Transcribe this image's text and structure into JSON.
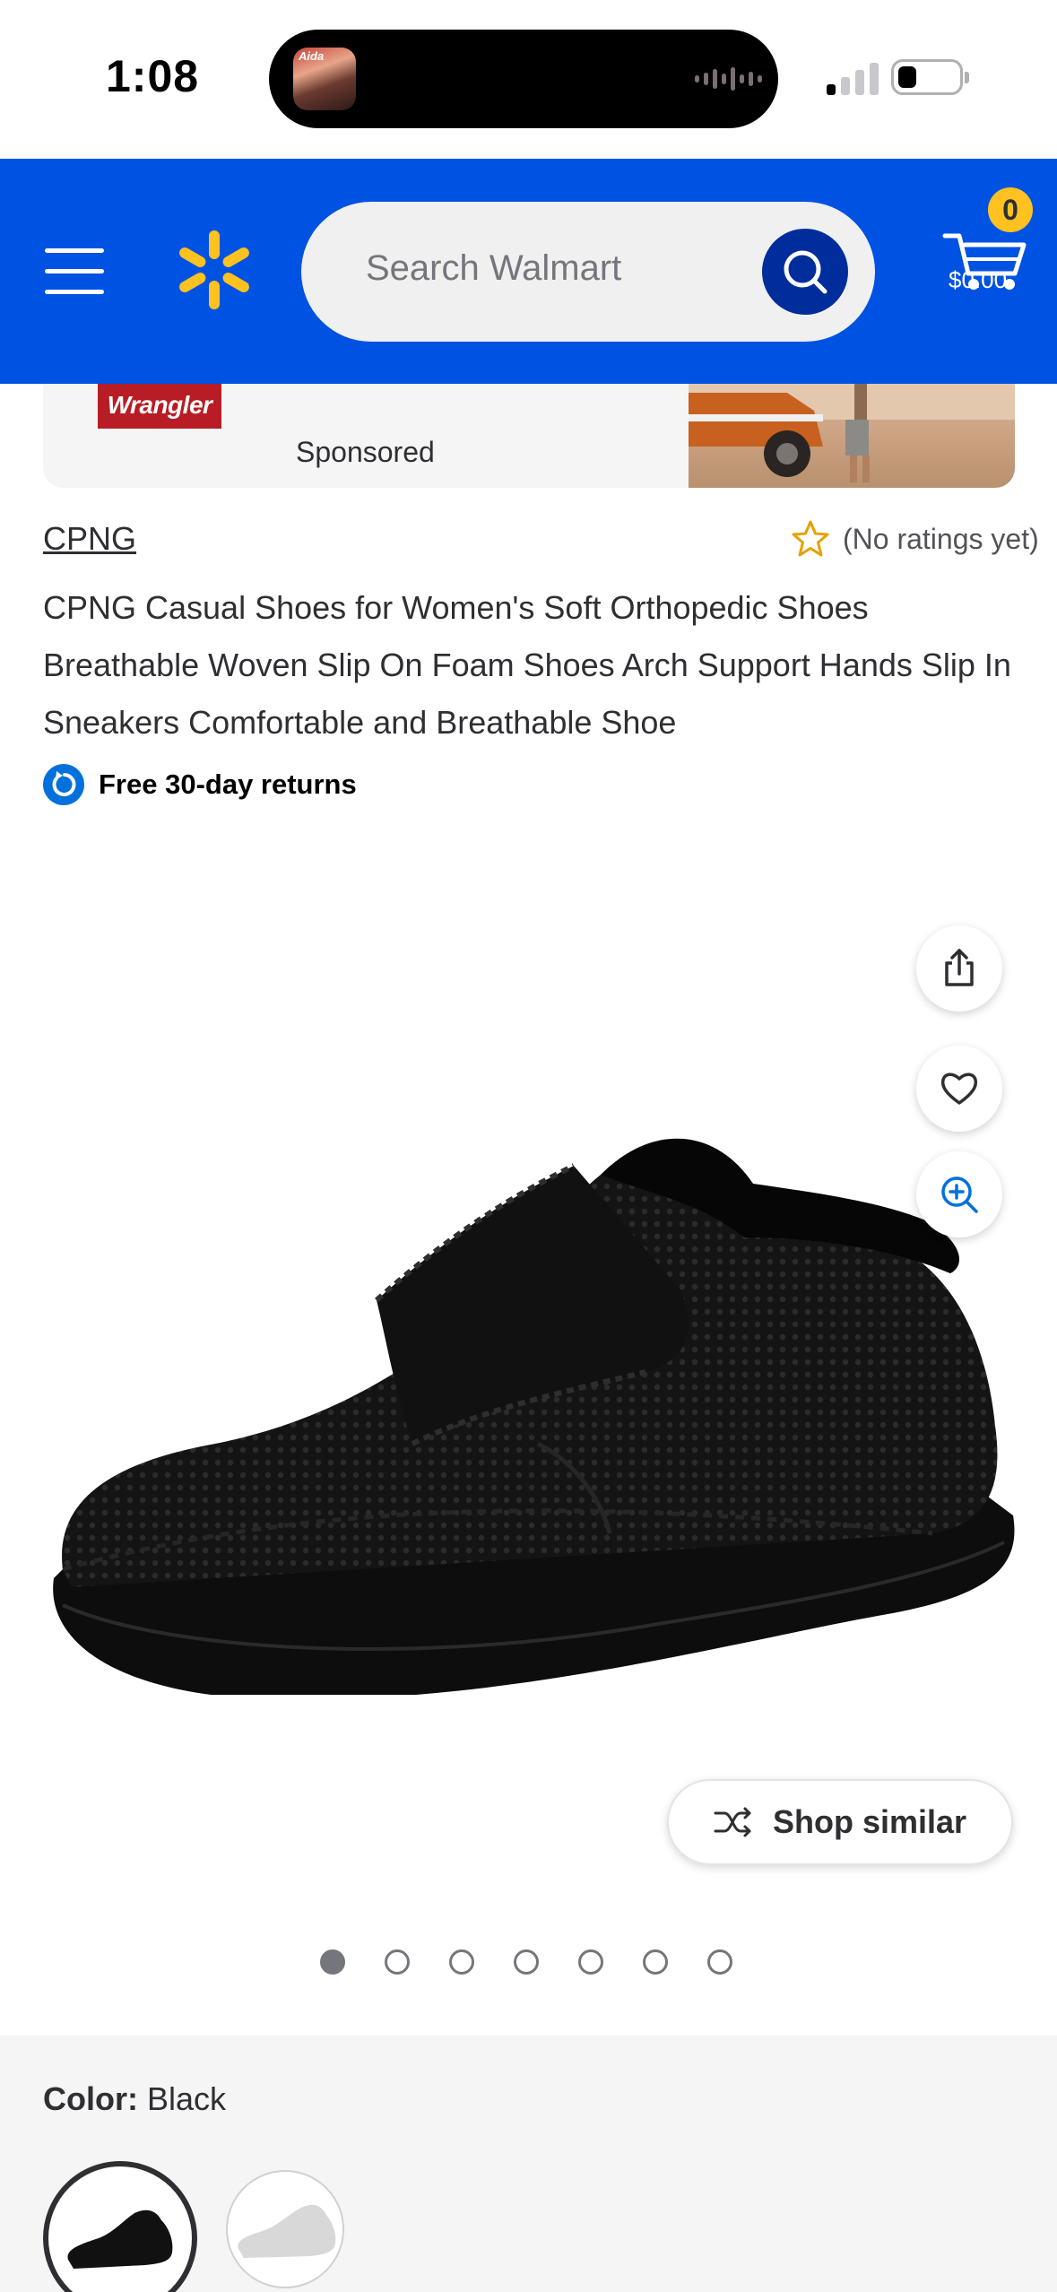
{
  "status_bar": {
    "time": "1:08",
    "island_art_label": "Aida"
  },
  "header": {
    "search_placeholder": "Search Walmart",
    "cart_count": "0",
    "cart_total": "$0.00",
    "brand_color": "#0053e2",
    "spark_color": "#ffc220"
  },
  "ad": {
    "logo_text": "Wrangler",
    "sponsored_label": "Sponsored"
  },
  "product": {
    "brand": "CPNG",
    "rating_text": "(No ratings yet)",
    "title": "CPNG Casual Shoes for Women's Soft Orthopedic Shoes Breathable Woven Slip On Foam Shoes Arch Support Hands Slip In Sneakers Comfortable and Breathable Shoe",
    "returns": "Free 30-day returns"
  },
  "image_actions": {
    "share_icon": "share-icon",
    "favorite_icon": "heart-icon",
    "zoom_icon": "zoom-in-icon",
    "shop_similar_label": "Shop similar"
  },
  "carousel": {
    "total": 7,
    "active_index": 0
  },
  "color": {
    "label": "Color:",
    "value": "Black",
    "options": [
      "Black",
      "White"
    ]
  }
}
